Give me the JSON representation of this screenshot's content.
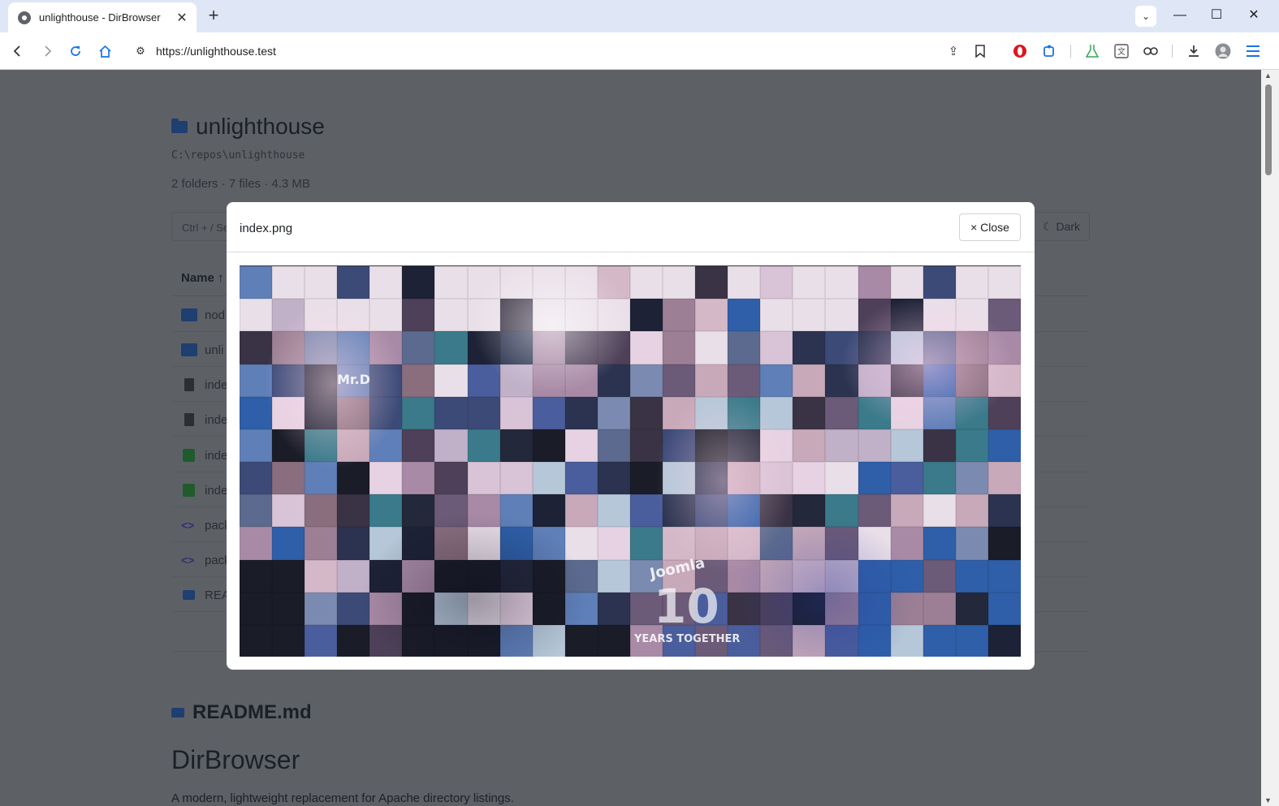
{
  "browser": {
    "tab_title": "unlighthouse - DirBrowser",
    "url": "https://unlighthouse.test"
  },
  "page": {
    "title": "unlighthouse",
    "path": "C:\\repos\\unlighthouse",
    "stats": "2 folders · 7 files · 4.3 MB",
    "search_placeholder_visible": "Ctrl + / Se",
    "dark_button_label": "☾ Dark",
    "table_header_name": "Name ↑",
    "rows": [
      {
        "type": "folder",
        "name_visible": "nod"
      },
      {
        "type": "folder",
        "name_visible": "unli"
      },
      {
        "type": "file",
        "name_visible": "inde"
      },
      {
        "type": "file",
        "name_visible": "inde"
      },
      {
        "type": "image",
        "name_visible": "inde"
      },
      {
        "type": "image",
        "name_visible": "inde"
      },
      {
        "type": "code",
        "name_visible": "pack"
      },
      {
        "type": "code",
        "name_visible": "pack"
      },
      {
        "type": "markdown",
        "name_visible": "REA"
      }
    ],
    "readme_title": "README.md",
    "readme_h1": "DirBrowser",
    "readme_text": "A modern, lightweight replacement for Apache directory listings."
  },
  "modal": {
    "title": "index.png",
    "close_label": "× Close",
    "image_texts": {
      "mrd": "Mr.D",
      "joomla": "Joomla",
      "ten": "10",
      "years": "YEARS TOGETHER"
    }
  },
  "colors": {
    "overlay_page": "#5d6166",
    "tabbar": "#dfe7f6",
    "folder_icon": "#1e3f70",
    "opera_red": "#e0141e",
    "extension_blue": "#1a73e8"
  }
}
